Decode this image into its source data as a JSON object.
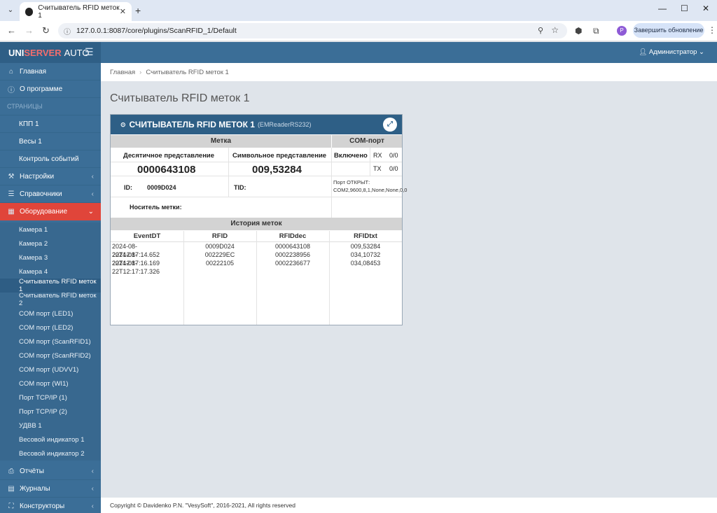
{
  "browser": {
    "tab_title": "Считыватель RFID меток 1",
    "url": "127.0.0.1:8087/core/plugins/ScanRFID_1/Default",
    "update_button": "Завершить обновление",
    "profile_initial": "P"
  },
  "app": {
    "brand_a": "UNI",
    "brand_b": "SERVER",
    "brand_c": "AUTO",
    "user": "Администратор"
  },
  "sidebar": {
    "items": [
      {
        "label": "Главная",
        "icon": "home-icon"
      },
      {
        "label": "О программе",
        "icon": "info-icon"
      },
      {
        "label": "СТРАНИЦЫ",
        "header": true
      },
      {
        "label": "КПП 1"
      },
      {
        "label": "Весы 1"
      },
      {
        "label": "Контроль событий"
      },
      {
        "label": "Настройки",
        "icon": "wrench-icon"
      },
      {
        "label": "Справочники",
        "icon": "database-icon"
      },
      {
        "label": "Оборудование",
        "icon": "table-icon"
      }
    ],
    "equipment": [
      "Камера 1",
      "Камера 2",
      "Камера 3",
      "Камера 4",
      "Считыватель RFID меток 1",
      "Считыватель RFID меток 2",
      "COM порт (LED1)",
      "COM порт (LED2)",
      "COM порт (ScanRFID1)",
      "COM порт (ScanRFID2)",
      "COM порт (UDVV1)",
      "COM порт (WI1)",
      "Порт TCP/IP (1)",
      "Порт TCP/IP (2)",
      "УДВВ 1",
      "Весовой индикатор 1",
      "Весовой индикатор 2"
    ],
    "tail": [
      {
        "label": "Отчёты",
        "icon": "print-icon"
      },
      {
        "label": "Журналы",
        "icon": "list-icon"
      },
      {
        "label": "Конструкторы",
        "icon": "sitemap-icon"
      }
    ]
  },
  "breadcrumb": {
    "home": "Главная",
    "current": "Считыватель RFID меток 1"
  },
  "page_title": "Считыватель RFID меток 1",
  "panel": {
    "title": "СЧИТЫВАТЕЛЬ RFID МЕТОК 1",
    "subtitle": "(EMReaderRS232)",
    "tag_header": "Метка",
    "com_header": "COM-порт",
    "dec_label": "Десятичное представление",
    "sym_label": "Символьное представление",
    "dec_value": "0000643108",
    "sym_value": "009,53284",
    "id_label": "ID:",
    "id_value": "0009D024",
    "tid_label": "TID:",
    "carrier_label": "Носитель метки:",
    "com_enabled": "Включено",
    "rx_label": "RX",
    "rx_value": "0/0",
    "tx_label": "TX",
    "tx_value": "0/0",
    "port_status": "Порт ОТКРЫТ: COM2,9600,8,1,None,None,0,0",
    "history_header": "История меток",
    "history_cols": [
      "EventDT",
      "RFID",
      "RFIDdec",
      "RFIDtxt"
    ],
    "history_rows": [
      [
        "2024-08-22T12:17:14.652",
        "0009D024",
        "0000643108",
        "009,53284"
      ],
      [
        "2024-08-22T12:17:16.169",
        "002229EC",
        "0002238956",
        "034,10732"
      ],
      [
        "2024-08-22T12:17:17.326",
        "00222105",
        "0002236677",
        "034,08453"
      ]
    ]
  },
  "footer": "Copyright © Davidenko P.N. \"VesySoft\", 2016-2021, All rights reserved"
}
